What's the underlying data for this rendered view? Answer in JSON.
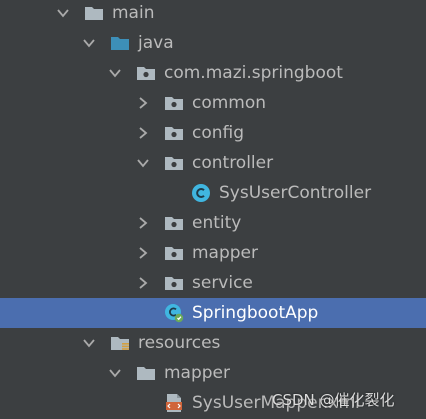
{
  "colors": {
    "background": "#3c3f41",
    "selected_row": "#4b6eaf",
    "text": "#bbbbbb",
    "folder_gray": "#aeb9c0",
    "folder_blue": "#3d8fb8",
    "class_cyan": "#40b6e0"
  },
  "tree": {
    "main": {
      "label": "main",
      "icon": "folder-icon",
      "expanded": true
    },
    "java": {
      "label": "java",
      "icon": "source-folder-icon",
      "expanded": true
    },
    "package": {
      "label": "com.mazi.springboot",
      "icon": "package-icon",
      "expanded": true
    },
    "common": {
      "label": "common",
      "icon": "package-icon",
      "expanded": false
    },
    "config": {
      "label": "config",
      "icon": "package-icon",
      "expanded": false
    },
    "controller": {
      "label": "controller",
      "icon": "package-icon",
      "expanded": true
    },
    "sys_user_controller": {
      "label": "SysUserController",
      "icon": "class-icon"
    },
    "entity": {
      "label": "entity",
      "icon": "package-icon",
      "expanded": false
    },
    "mapper": {
      "label": "mapper",
      "icon": "package-icon",
      "expanded": false
    },
    "service": {
      "label": "service",
      "icon": "package-icon",
      "expanded": false
    },
    "springboot_app": {
      "label": "SpringbootApp",
      "icon": "spring-boot-class-icon",
      "selected": true
    },
    "resources": {
      "label": "resources",
      "icon": "resources-folder-icon",
      "expanded": true
    },
    "res_mapper": {
      "label": "mapper",
      "icon": "folder-icon",
      "expanded": true
    },
    "sys_user_mapper_xml": {
      "label": "SysUserMapper.xml",
      "icon": "xml-file-icon"
    }
  },
  "watermark": {
    "text": "CSDN @催化裂化"
  }
}
